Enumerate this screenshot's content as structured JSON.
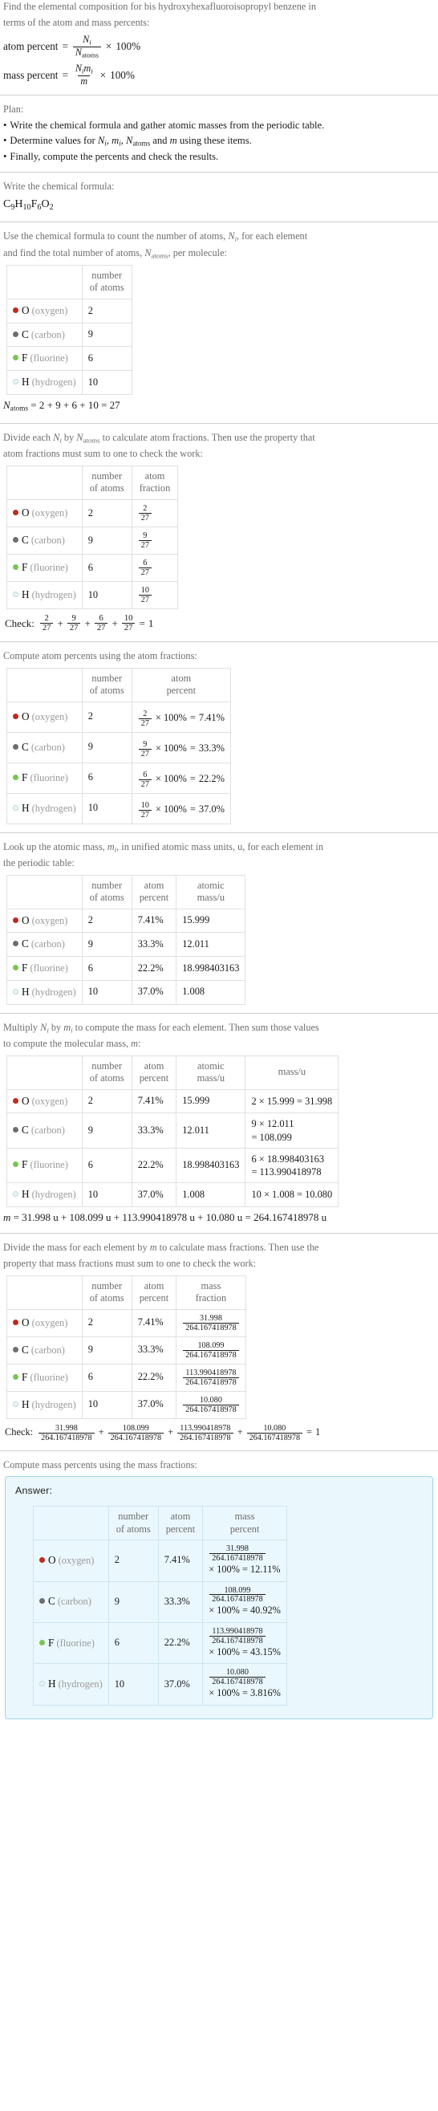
{
  "intro": {
    "question_line1": "Find the elemental composition for bis hydroxyhexafluoroisopropyl benzene in",
    "question_line2": "terms of the atom and mass percents:",
    "atom_percent_label": "atom percent",
    "mass_percent_label": "mass percent",
    "equals": "=",
    "times": "×",
    "hundred_percent": "100%"
  },
  "plan": {
    "heading": "Plan:",
    "items": [
      "Write the chemical formula and gather atomic masses from the periodic table.",
      "Determine values for N_i, m_i, N_atoms and m using these items.",
      "Finally, compute the percents and check the results."
    ],
    "item3": "Finally, compute the percents and check the results."
  },
  "formula_section": {
    "prompt": "Write the chemical formula:",
    "formula_parts": [
      {
        "sym": "C",
        "n": "9"
      },
      {
        "sym": "H",
        "n": "10"
      },
      {
        "sym": "F",
        "n": "6"
      },
      {
        "sym": "O",
        "n": "2"
      }
    ],
    "formula_text": "C9H10F6O2"
  },
  "count_section": {
    "prompt_line1": "Use the chemical formula to count the number of atoms, Ni, for each element",
    "prompt_line2": "and find the total number of atoms, Natoms, per molecule:",
    "headers": {
      "blank": "",
      "number_of_atoms": "number\nof atoms"
    },
    "header_number_l1": "number",
    "header_number_l2": "of atoms",
    "total_label": "N",
    "total_sub": "atoms",
    "total_expr": "= 2 + 9 + 6 + 10 = 27"
  },
  "elements": [
    {
      "symbol": "O",
      "name": "(oxygen)",
      "color": "#c02a1c",
      "filled": true,
      "count": "2",
      "atom_fraction_num": "2",
      "atom_fraction_den": "27",
      "atom_percent": "7.41%",
      "atomic_mass": "15.999",
      "mass_expr": "2 × 15.999 = 31.998",
      "mass_expr_l1": "2 × 15.999 = 31.998",
      "mass_expr_l2": "",
      "mass_value": "31.998"
    },
    {
      "symbol": "C",
      "name": "(carbon)",
      "color": "#6e6e6e",
      "filled": true,
      "count": "9",
      "atom_fraction_num": "9",
      "atom_fraction_den": "27",
      "atom_percent": "33.3%",
      "atomic_mass": "12.011",
      "mass_expr": "9 × 12.011 = 108.099",
      "mass_expr_l1": "9 × 12.011",
      "mass_expr_l2": "= 108.099",
      "mass_value": "108.099"
    },
    {
      "symbol": "F",
      "name": "(fluorine)",
      "color": "#79c551",
      "filled": true,
      "count": "6",
      "atom_fraction_num": "6",
      "atom_fraction_den": "27",
      "atom_percent": "22.2%",
      "atomic_mass": "18.998403163",
      "mass_expr": "6 × 18.998403163 = 113.990418978",
      "mass_expr_l1": "6 × 18.998403163",
      "mass_expr_l2": "= 113.990418978",
      "mass_value": "113.990418978"
    },
    {
      "symbol": "H",
      "name": "(hydrogen)",
      "color": "#e8f6f8",
      "filled": false,
      "count": "10",
      "atom_fraction_num": "10",
      "atom_fraction_den": "27",
      "atom_percent": "37.0%",
      "atomic_mass": "1.008",
      "mass_expr": "10 × 1.008 = 10.080",
      "mass_expr_l1": "10 × 1.008 = 10.080",
      "mass_expr_l2": "",
      "mass_value": "10.080"
    }
  ],
  "atom_fraction_section": {
    "prompt_line1": "Divide each Ni by Natoms to calculate atom fractions. Then use the property that",
    "prompt_line2": "atom fractions must sum to one to check the work:",
    "header_atom_l1": "atom",
    "header_atom_l2": "fraction",
    "check_label": "Check:",
    "check_result": "1"
  },
  "atom_percent_section": {
    "prompt": "Compute atom percents using the atom fractions:",
    "header_l1": "atom",
    "header_l2": "percent"
  },
  "atomic_mass_section": {
    "prompt_line1": "Look up the atomic mass, mi, in unified atomic mass units, u, for each element in",
    "prompt_line2": "the periodic table:",
    "header_l1": "atomic",
    "header_l2": "mass/u"
  },
  "multiply_section": {
    "prompt_line1": "Multiply Ni by mi to compute the mass for each element. Then sum those values",
    "prompt_line2": "to compute the molecular mass, m:",
    "header_mass": "mass/u",
    "total_line": "m = 31.998 u + 108.099 u + 113.990418978 u + 10.080 u = 264.167418978 u",
    "total_symbol": "m",
    "total_expr": "= 31.998 u + 108.099 u + 113.990418978 u + 10.080 u = 264.167418978 u"
  },
  "mass_fraction_section": {
    "prompt_line1": "Divide the mass for each element by m to calculate mass fractions. Then use the",
    "prompt_line2": "property that mass fractions must sum to one to check the work:",
    "header_l1": "mass",
    "header_l2": "fraction",
    "denominator": "264.167418978",
    "check_label": "Check:",
    "check_result": "1"
  },
  "mass_percent_section": {
    "prompt": "Compute mass percents using the mass fractions:",
    "answer_label": "Answer:",
    "header_l1": "mass",
    "header_l2": "percent",
    "denominator": "264.167418978",
    "times_100": "× 100%",
    "results": [
      "12.11%",
      "40.92%",
      "43.15%",
      "3.816%"
    ]
  },
  "colors": {
    "answer_bg": "#eaf7fd",
    "answer_border": "#9fd4e8",
    "rule": "#cfcfcf",
    "muted_text": "#6e6e6e",
    "element_name": "#9a9a9a"
  }
}
